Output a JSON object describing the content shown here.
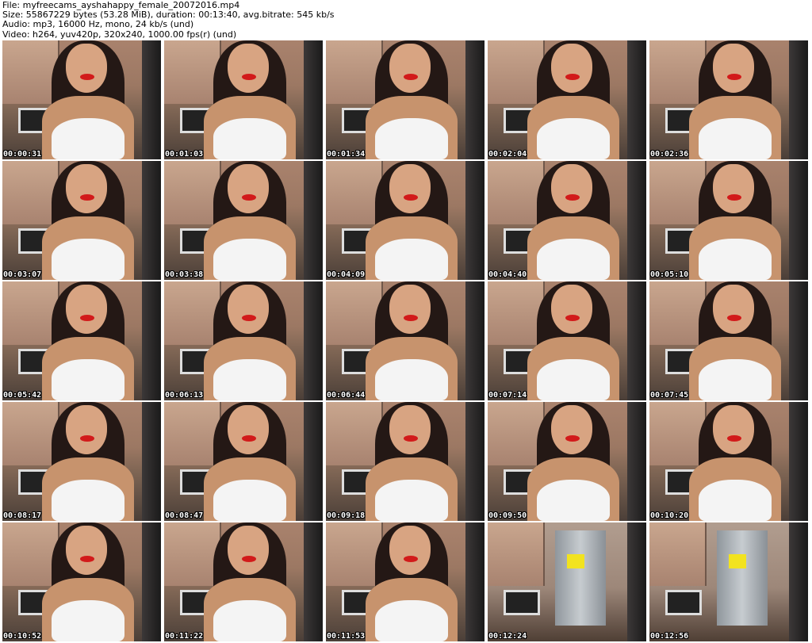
{
  "header": {
    "file": "File: myfreecams_ayshahappy_female_20072016.mp4",
    "size": "Size: 55867229 bytes (53.28 MiB), duration: 00:13:40, avg.bitrate: 545 kb/s",
    "audio": "Audio: mp3, 16000 Hz, mono, 24 kb/s (und)",
    "video": "Video: h264, yuv420p, 320x240, 1000.00 fps(r) (und)"
  },
  "thumbnails": [
    {
      "timestamp": "00:00:31"
    },
    {
      "timestamp": "00:01:03"
    },
    {
      "timestamp": "00:01:34"
    },
    {
      "timestamp": "00:02:04"
    },
    {
      "timestamp": "00:02:36"
    },
    {
      "timestamp": "00:03:07"
    },
    {
      "timestamp": "00:03:38"
    },
    {
      "timestamp": "00:04:09"
    },
    {
      "timestamp": "00:04:40"
    },
    {
      "timestamp": "00:05:10"
    },
    {
      "timestamp": "00:05:42"
    },
    {
      "timestamp": "00:06:13"
    },
    {
      "timestamp": "00:06:44"
    },
    {
      "timestamp": "00:07:14"
    },
    {
      "timestamp": "00:07:45"
    },
    {
      "timestamp": "00:08:17"
    },
    {
      "timestamp": "00:08:47"
    },
    {
      "timestamp": "00:09:18"
    },
    {
      "timestamp": "00:09:50"
    },
    {
      "timestamp": "00:10:20"
    },
    {
      "timestamp": "00:10:52"
    },
    {
      "timestamp": "00:11:22"
    },
    {
      "timestamp": "00:11:53"
    },
    {
      "timestamp": "00:12:24",
      "scene": "kitchen-fridge"
    },
    {
      "timestamp": "00:12:56",
      "scene": "kitchen-fridge"
    }
  ]
}
